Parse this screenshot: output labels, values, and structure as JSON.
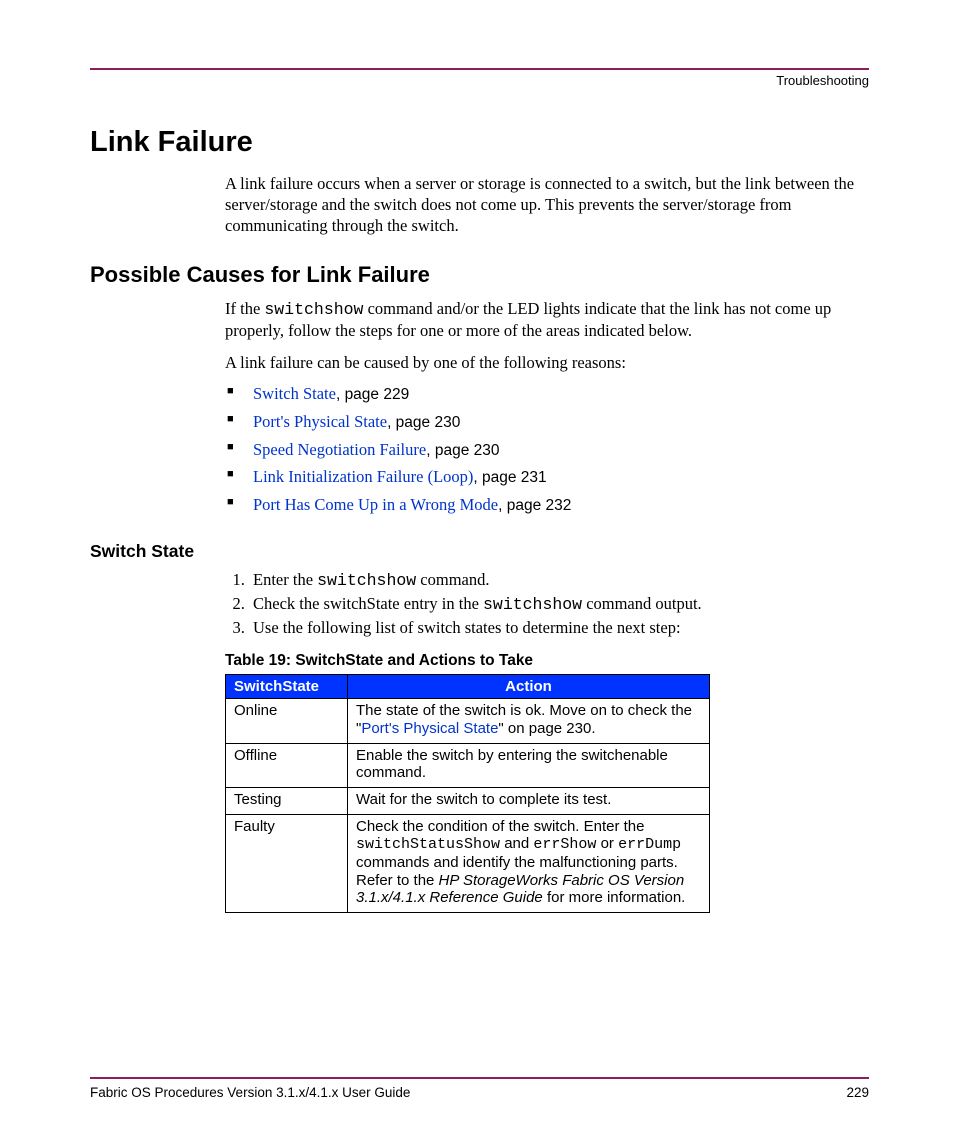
{
  "header": {
    "section": "Troubleshooting"
  },
  "footer": {
    "doc": "Fabric OS Procedures Version 3.1.x/4.1.x User Guide",
    "page": "229"
  },
  "h1": "Link Failure",
  "intro": "A link failure occurs when a server or storage is connected to a switch, but the link between the server/storage and the switch does not come up. This prevents the server/storage from communicating through the switch.",
  "h2": "Possible Causes for Link Failure",
  "p1a": "If the ",
  "p1_cmd": "switchshow",
  "p1b": " command and/or the LED lights indicate that the link has not come up properly, follow the steps for one or more of the areas indicated below.",
  "p2": "A link failure can be caused by one of the following reasons:",
  "bullets": [
    {
      "link": "Switch State",
      "suffix": ", page 229"
    },
    {
      "link": "Port's Physical State",
      "suffix": ", page 230"
    },
    {
      "link": "Speed Negotiation Failure",
      "suffix": ", page 230"
    },
    {
      "link": "Link Initialization Failure (Loop)",
      "suffix": ", page 231"
    },
    {
      "link": "Port Has Come Up in a Wrong Mode",
      "suffix": ", page 232"
    }
  ],
  "h3": "Switch State",
  "steps": {
    "s1a": "Enter the ",
    "s1_cmd": "switchshow",
    "s1b": " command.",
    "s2a": "Check the switchState entry in the ",
    "s2_cmd": "switchshow",
    "s2b": " command output.",
    "s3": "Use the following list of switch states to determine the next step:"
  },
  "table_caption": "Table 19:  SwitchState and Actions to Take",
  "table": {
    "h1": "SwitchState",
    "h2": "Action",
    "rows": [
      {
        "state": "Online",
        "a1": "The state of the switch is ok. Move on to check the \"",
        "a_link": "Port's Physical State",
        "a2": "\" on page 230."
      },
      {
        "state": "Offline",
        "a1": "Enable the switch by entering the switchenable command."
      },
      {
        "state": "Testing",
        "a1": "Wait for the switch to complete its test."
      },
      {
        "state": "Faulty",
        "a1": "Check the condition of the switch. Enter the ",
        "c1": "switchStatusShow",
        "a2": " and ",
        "c2": "errShow",
        "a3": " or ",
        "c3": "errDump",
        "a4": " commands and identify the malfunctioning parts. Refer to the ",
        "ital": "HP StorageWorks Fabric OS Version 3.1.x/4.1.x Reference Guide",
        "a5": " for more information."
      }
    ]
  }
}
